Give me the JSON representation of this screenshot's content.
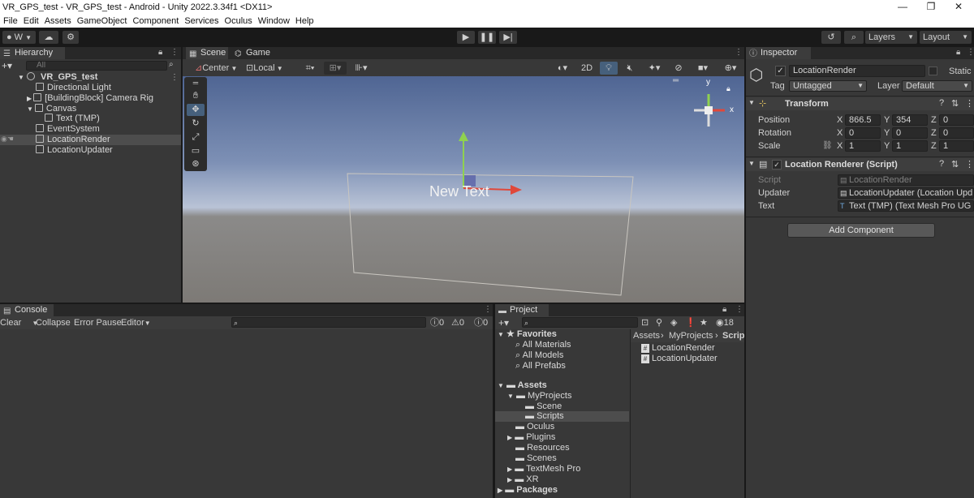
{
  "window": {
    "title": "VR_GPS_test - VR_GPS_test - Android - Unity 2022.3.34f1 <DX11>",
    "minimize": "—",
    "maximize": "❐",
    "close": "✕"
  },
  "menu": [
    "File",
    "Edit",
    "Assets",
    "GameObject",
    "Component",
    "Services",
    "Oculus",
    "Window",
    "Help"
  ],
  "toolbar": {
    "account": "W",
    "layers": "Layers",
    "layout": "Layout"
  },
  "hierarchy": {
    "tab": "Hierarchy",
    "search_placeholder": "All",
    "scene": "VR_GPS_test",
    "items": [
      {
        "label": "Directional Light"
      },
      {
        "label": "[BuildingBlock] Camera Rig"
      },
      {
        "label": "Canvas"
      },
      {
        "label": "Text (TMP)"
      },
      {
        "label": "EventSystem"
      },
      {
        "label": "LocationRender"
      },
      {
        "label": "LocationUpdater"
      }
    ]
  },
  "scene_view": {
    "tabs": [
      "Scene",
      "Game"
    ],
    "pivot": "Center",
    "space": "Local",
    "mode_2d": "2D",
    "canvas_text": "New Text"
  },
  "inspector": {
    "tab": "Inspector",
    "object_name": "LocationRender",
    "static_label": "Static",
    "tag_label": "Tag",
    "tag_value": "Untagged",
    "layer_label": "Layer",
    "layer_value": "Default",
    "transform": {
      "title": "Transform",
      "position_label": "Position",
      "rotation_label": "Rotation",
      "scale_label": "Scale",
      "position": {
        "x": "866.5",
        "y": "354",
        "z": "0"
      },
      "rotation": {
        "x": "0",
        "y": "0",
        "z": "0"
      },
      "scale": {
        "x": "1",
        "y": "1",
        "z": "1"
      }
    },
    "script_component": {
      "title": "Location Renderer (Script)",
      "script_label": "Script",
      "script_value": "LocationRender",
      "updater_label": "Updater",
      "updater_value": "LocationUpdater (Location Upd",
      "text_label": "Text",
      "text_value": "Text (TMP) (Text Mesh Pro UG"
    },
    "add_component": "Add Component"
  },
  "console": {
    "tab": "Console",
    "clear": "Clear",
    "collapse": "Collapse",
    "error_pause": "Error Pause",
    "editor": "Editor",
    "log_count": "0",
    "warn_count": "0",
    "error_count": "0"
  },
  "project": {
    "tab": "Project",
    "hidden_count": "18",
    "favorites": {
      "label": "Favorites",
      "items": [
        "All Materials",
        "All Models",
        "All Prefabs"
      ]
    },
    "assets": {
      "label": "Assets",
      "myprojects": "MyProjects",
      "myprojects_children": [
        "Scene",
        "Scripts"
      ],
      "others": [
        "Oculus",
        "Plugins",
        "Resources",
        "Scenes",
        "TextMesh Pro",
        "XR"
      ]
    },
    "packages": "Packages",
    "breadcrumb": [
      "Assets",
      "MyProjects",
      "Script"
    ],
    "files": [
      "LocationRender",
      "LocationUpdater"
    ]
  },
  "colors": {
    "panel": "#383838",
    "selected_row": "#4d4d4d",
    "accent_y": "#8fd14f",
    "accent_x": "#e0483a"
  }
}
